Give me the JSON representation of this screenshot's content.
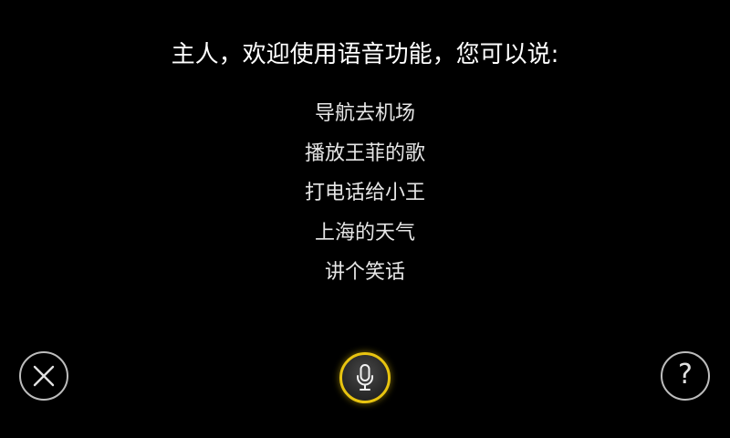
{
  "prompt": {
    "title": "主人，欢迎使用语音功能，您可以说:"
  },
  "suggestions": [
    "导航去机场",
    "播放王菲的歌",
    "打电话给小王",
    "上海的天气",
    "讲个笑话"
  ],
  "controls": {
    "close_icon": "close-icon",
    "mic_icon": "microphone-icon",
    "help_icon": "question-mark-icon",
    "help_glyph": "?"
  },
  "colors": {
    "background": "#000000",
    "text": "#ffffff",
    "accent": "#e8c410",
    "button_ring": "#bdbdbd"
  }
}
